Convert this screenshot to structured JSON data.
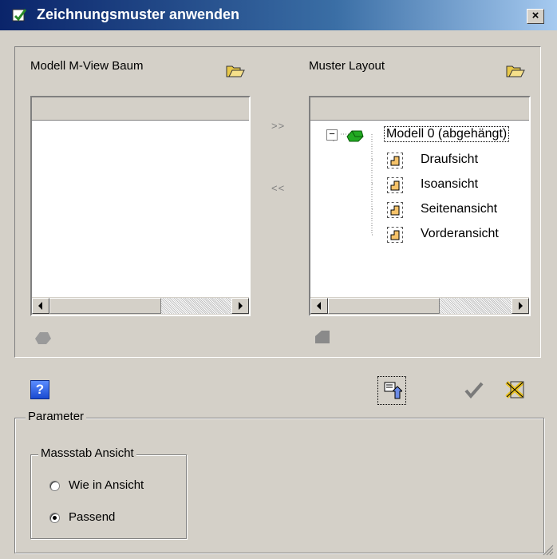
{
  "window": {
    "title": "Zeichnungsmuster anwenden",
    "close_glyph": "×"
  },
  "left_panel": {
    "label": "Modell M-View Baum"
  },
  "right_panel": {
    "label": "Muster Layout",
    "tree": {
      "expander": "−",
      "root_label": "Modell 0 (abgehängt)",
      "children": [
        "Draufsicht",
        "Isoansicht",
        "Seitenansicht",
        "Vorderansicht"
      ]
    }
  },
  "transfer": {
    "add_label": ">>",
    "remove_label": "<<"
  },
  "toolbar": {
    "help_label": "?"
  },
  "parameter": {
    "group_label": "Parameter",
    "scale_group_label": "Massstab Ansicht",
    "options": [
      {
        "label": "Wie in Ansicht",
        "selected": false
      },
      {
        "label": "Passend",
        "selected": true
      }
    ]
  },
  "colors": {
    "title_start": "#0a246a",
    "title_end": "#a6caf0",
    "face": "#d4d0c8"
  }
}
